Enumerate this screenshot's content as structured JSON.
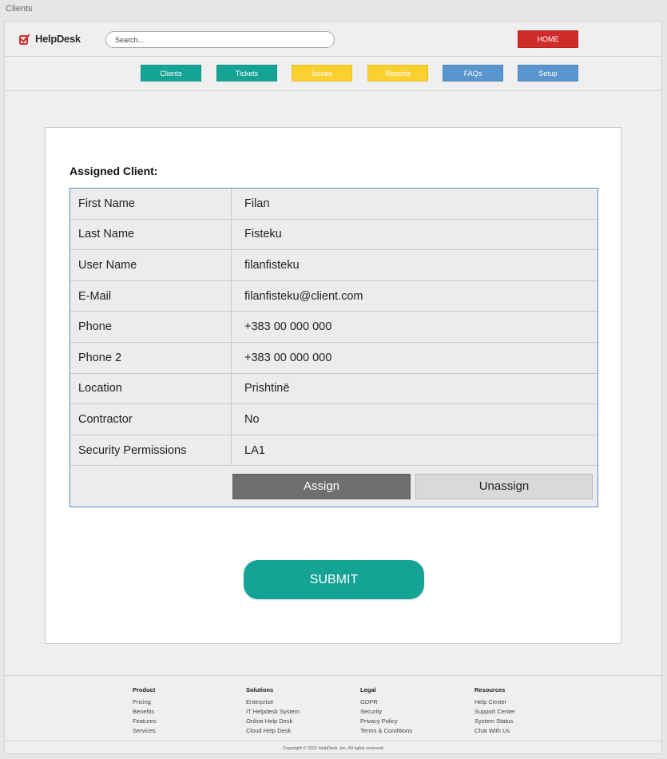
{
  "window": {
    "title": "Clients"
  },
  "header": {
    "brand": "HelpDesk",
    "search_placeholder": "Search...",
    "home_label": "HOME"
  },
  "nav": [
    {
      "label": "Clients",
      "color": "#15a396"
    },
    {
      "label": "Tickets",
      "color": "#15a396"
    },
    {
      "label": "Issues",
      "color": "#fbd031"
    },
    {
      "label": "Reports",
      "color": "#fbd031"
    },
    {
      "label": "FAQs",
      "color": "#5a95cf"
    },
    {
      "label": "Setup",
      "color": "#5a95cf"
    }
  ],
  "card": {
    "title": "Assigned Client:",
    "rows": [
      {
        "label": "First Name",
        "value": "Filan"
      },
      {
        "label": "Last Name",
        "value": "Fisteku"
      },
      {
        "label": "User Name",
        "value": "filanfisteku"
      },
      {
        "label": "E-Mail",
        "value": "filanfisteku@client.com"
      },
      {
        "label": "Phone",
        "value": "+383 00 000 000"
      },
      {
        "label": "Phone 2",
        "value": "+383 00 000 000"
      },
      {
        "label": "Location",
        "value": "Prishtinë"
      },
      {
        "label": "Contractor",
        "value": "No"
      },
      {
        "label": "Security Permissions",
        "value": "LA1"
      }
    ],
    "assign_label": "Assign",
    "unassign_label": "Unassign",
    "submit_label": "SUBMIT"
  },
  "footer": {
    "columns": [
      {
        "title": "Product",
        "links": [
          "Pricing",
          "Benefits",
          "Features",
          "Services"
        ]
      },
      {
        "title": "Solutions",
        "links": [
          "Enterprise",
          "IT Helpdesk System",
          "Online Help Desk",
          "Cloud Help Desk"
        ]
      },
      {
        "title": "Legal",
        "links": [
          "GDPR",
          "Security",
          "Privacy Policy",
          "Terms & Conditions"
        ]
      },
      {
        "title": "Resources",
        "links": [
          "Help Center",
          "Support Center",
          "System Status",
          "Chat With Us"
        ]
      }
    ],
    "copyright": "Copyright © 2021 HelpDesk, Inc. All rights reserved"
  }
}
